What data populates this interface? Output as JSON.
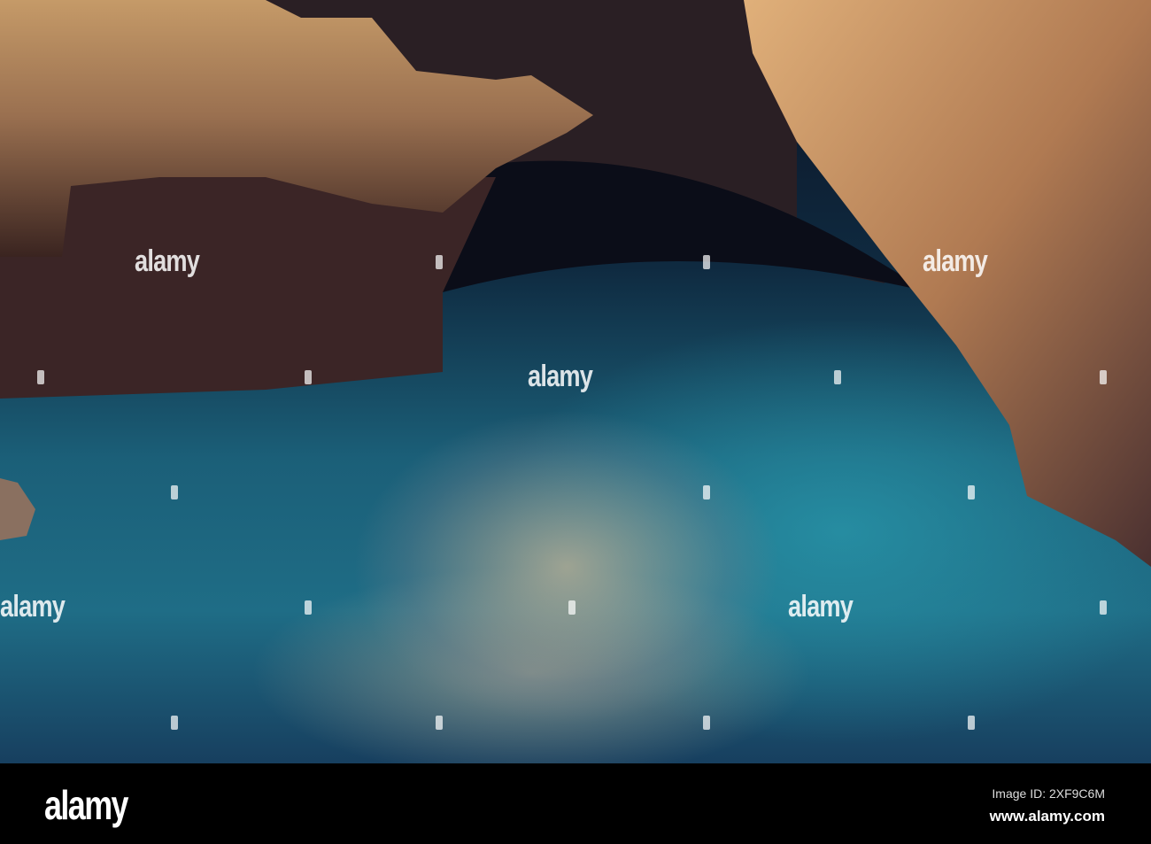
{
  "watermark": {
    "text": "alamy"
  },
  "footer": {
    "logo": "alamy",
    "image_id": "Image ID: 2XF9C6M",
    "website": "www.alamy.com"
  },
  "colors": {
    "water": "#1f6d86",
    "rock": "#c8955e",
    "cave": "#0b0d18"
  }
}
